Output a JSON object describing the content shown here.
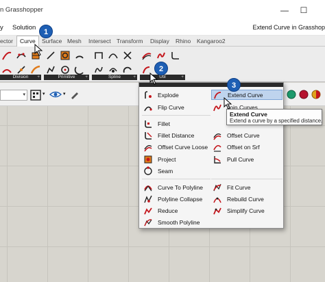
{
  "window": {
    "title": "n Grasshopper",
    "controls": {
      "minimize": "—",
      "maximize": "☐"
    }
  },
  "menubar": {
    "items": [
      "y",
      "Solution"
    ],
    "breadcrumb": "Extend Curve in Grasshop"
  },
  "tabs": [
    "ector",
    "Curve",
    "Surface",
    "Mesh",
    "Intersect",
    "Transform",
    "Display",
    "Rhino",
    "Kangaroo2"
  ],
  "active_tab": "Curve",
  "ribbon": {
    "groups": [
      {
        "label": "Division"
      },
      {
        "label": "Primitive"
      },
      {
        "label": "Spline"
      },
      {
        "label": "Util"
      }
    ]
  },
  "dropdown": {
    "left_column": [
      "Explode",
      "Flip Curve",
      "Fillet",
      "Fillet Distance",
      "Offset Curve Loose",
      "Project",
      "Seam",
      "Curve To Polyline",
      "Polyline Collapse",
      "Reduce",
      "Smooth Polyline"
    ],
    "right_column": [
      "Extend Curve",
      "Join Curves",
      "Fit Curve",
      "Offset Curve",
      "Offset on Srf",
      "Pull Curve",
      "Fit Curve",
      "Rebuild Curve",
      "Simplify Curve"
    ],
    "highlighted": "Extend Curve"
  },
  "tooltip": {
    "title": "Extend Curve",
    "description": "Extend a curve by a specified distance."
  },
  "badges": [
    "1",
    "2",
    "3"
  ],
  "colors": {
    "badge": "#1e5fb4",
    "highlight": "#bfd4ee",
    "ribbon_bar": "#2a2a2a",
    "accent_red": "#c4161c",
    "accent_orange": "#e07b1a"
  }
}
